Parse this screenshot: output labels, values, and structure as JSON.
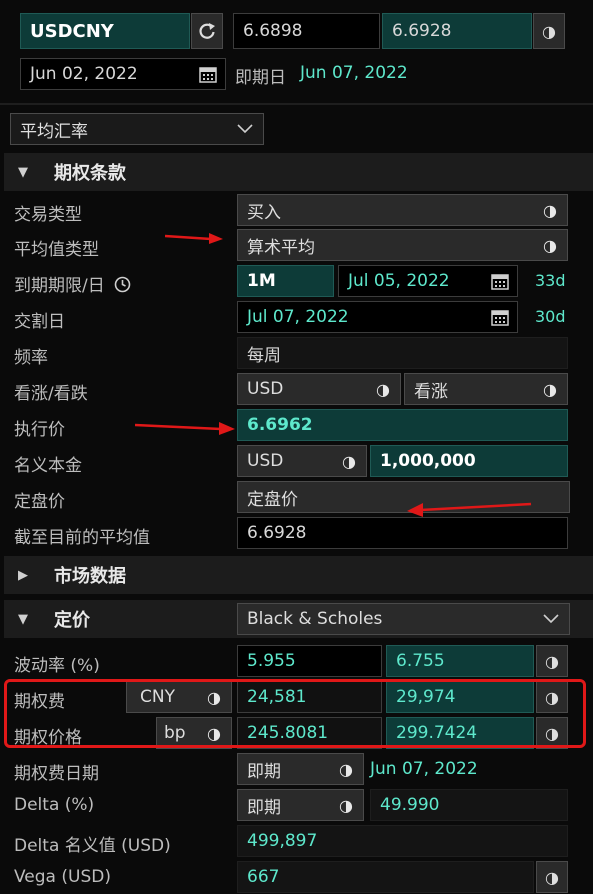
{
  "top": {
    "pair": "USDCNY",
    "bid": "6.6898",
    "ask": "6.6928",
    "trade_date": "Jun 02, 2022",
    "expiry_label": "即期日",
    "expiry_date": "Jun 07, 2022"
  },
  "mode_select": "平均汇率",
  "sections": {
    "terms": "期权条款",
    "market": "市场数据",
    "pricing": "定价"
  },
  "terms": {
    "trade_type_label": "交易类型",
    "trade_type_value": "买入",
    "avg_type_label": "平均值类型",
    "avg_type_value": "算术平均",
    "expiry_label": "到期期限/日",
    "tenor": "1M",
    "expiry_date": "Jul 05, 2022",
    "expiry_days": "33d",
    "delivery_label": "交割日",
    "delivery_date": "Jul 07, 2022",
    "delivery_days": "30d",
    "freq_label": "频率",
    "freq_value": "每周",
    "callput_label": "看涨/看跌",
    "callput_ccy": "USD",
    "callput_value": "看涨",
    "strike_label": "执行价",
    "strike_value": "6.6962",
    "notional_label": "名义本金",
    "notional_ccy": "USD",
    "notional_value": "1,000,000",
    "fixing_label": "定盘价",
    "fixing_button": "定盘价",
    "avg_to_date_label": "截至目前的平均值",
    "avg_to_date_value": "6.6928"
  },
  "pricing": {
    "model": "Black & Scholes",
    "vol_label": "波动率 (%)",
    "vol_bid": "5.955",
    "vol_ask": "6.755",
    "premium_label": "期权费",
    "premium_ccy": "CNY",
    "premium_bid": "24,581",
    "premium_ask": "29,974",
    "price_label": "期权价格",
    "price_unit": "bp",
    "price_bid": "245.8081",
    "price_ask": "299.7424",
    "premium_date_label": "期权费日期",
    "premium_date_type": "即期",
    "premium_date": "Jun 07, 2022",
    "delta_label": "Delta (%)",
    "delta_type": "即期",
    "delta_value": "49.990",
    "delta_notional_label": "Delta 名义值 (USD)",
    "delta_notional_value": "499,897",
    "vega_label": "Vega (USD)",
    "vega_value": "667"
  },
  "icons": {
    "refresh": "refresh-icon",
    "half": "half-circle-toggle-icon",
    "calendar": "calendar-icon",
    "clock": "clock-icon",
    "chevron": "chevron-down-icon",
    "triangle": "section-toggle-icon"
  },
  "colors": {
    "accent_teal": "#5ee8cc",
    "teal_field": "#0d3b38",
    "highlight_red": "#e01818"
  }
}
